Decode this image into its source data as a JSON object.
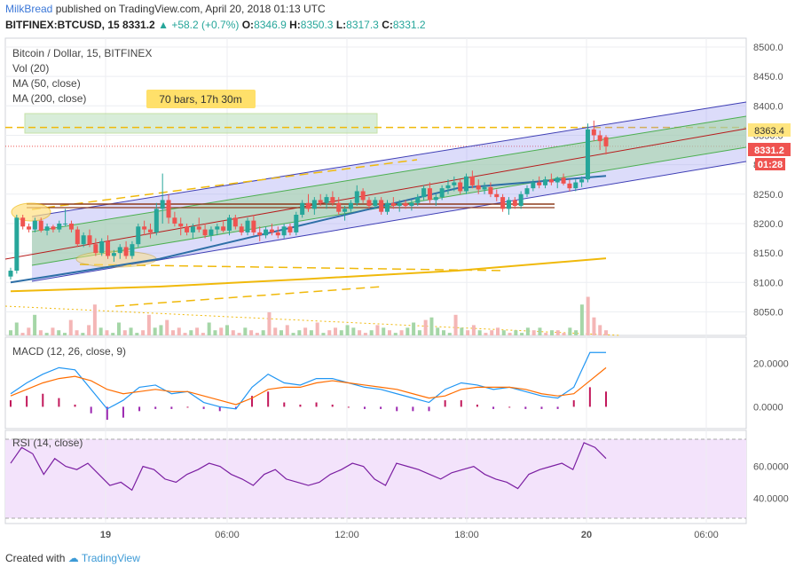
{
  "header": {
    "author": "MilkBread",
    "published": "published on TradingView.com, April 20, 2018 01:13 UTC",
    "symbol": "BITFINEX:BTCUSD, 15",
    "last": "8331.2",
    "change": "+58.2 (+0.7%)",
    "o_label": "O:",
    "o": "8346.9",
    "h_label": "H:",
    "h": "8350.3",
    "l_label": "L:",
    "l": "8317.3",
    "c_label": "C:",
    "c": "8331.2"
  },
  "legend": {
    "title": "Bitcoin / Dollar, 15, BITFINEX",
    "vol": "Vol (20)",
    "ma50": "MA (50, close)",
    "ma200": "MA (200, close)"
  },
  "annotation": {
    "bars": "70 bars, 17h 30m"
  },
  "badges": {
    "level": "8363.4",
    "last": "8331.2",
    "countdown": "01:28"
  },
  "colors": {
    "up": "#26a69a",
    "down": "#ef5350",
    "channel_blue": "#3f3fb5",
    "channel_green": "#4caf50",
    "ma50": "#2e6fa7",
    "ma200": "#f0b90b"
  },
  "chart_data": [
    {
      "type": "candlestick",
      "title": "Bitcoin / Dollar, 15, BITFINEX",
      "y_ticks": [
        "8050.0",
        "8100.0",
        "8150.0",
        "8200.0",
        "8250.0",
        "8300.0",
        "8350.0",
        "8400.0",
        "8450.0",
        "8500.0"
      ],
      "ylim": [
        8010,
        8515
      ],
      "x_ticks": [
        "19",
        "06:00",
        "12:00",
        "18:00",
        "20",
        "06:00"
      ],
      "level_8363": 8363.4,
      "candles": [
        [
          8110,
          8125,
          8105,
          8120
        ],
        [
          8120,
          8215,
          8115,
          8210
        ],
        [
          8210,
          8215,
          8190,
          8195
        ],
        [
          8195,
          8200,
          8185,
          8190
        ],
        [
          8190,
          8210,
          8185,
          8205
        ],
        [
          8205,
          8210,
          8185,
          8188
        ],
        [
          8188,
          8200,
          8180,
          8195
        ],
        [
          8195,
          8198,
          8185,
          8190
        ],
        [
          8190,
          8205,
          8185,
          8200
        ],
        [
          8200,
          8225,
          8195,
          8200
        ],
        [
          8200,
          8205,
          8185,
          8190
        ],
        [
          8190,
          8195,
          8160,
          8165
        ],
        [
          8165,
          8185,
          8160,
          8180
        ],
        [
          8180,
          8190,
          8160,
          8165
        ],
        [
          8165,
          8175,
          8145,
          8150
        ],
        [
          8150,
          8175,
          8145,
          8170
        ],
        [
          8170,
          8180,
          8140,
          8145
        ],
        [
          8145,
          8155,
          8135,
          8150
        ],
        [
          8150,
          8165,
          8140,
          8160
        ],
        [
          8160,
          8170,
          8140,
          8145
        ],
        [
          8145,
          8170,
          8140,
          8165
        ],
        [
          8165,
          8200,
          8160,
          8195
        ],
        [
          8195,
          8205,
          8180,
          8190
        ],
        [
          8190,
          8200,
          8175,
          8185
        ],
        [
          8185,
          8235,
          8180,
          8225
        ],
        [
          8225,
          8285,
          8200,
          8240
        ],
        [
          8240,
          8250,
          8200,
          8210
        ],
        [
          8210,
          8220,
          8195,
          8200
        ],
        [
          8200,
          8210,
          8180,
          8195
        ],
        [
          8195,
          8200,
          8180,
          8185
        ],
        [
          8185,
          8200,
          8175,
          8195
        ],
        [
          8195,
          8210,
          8185,
          8190
        ],
        [
          8190,
          8200,
          8175,
          8180
        ],
        [
          8180,
          8195,
          8170,
          8190
        ],
        [
          8190,
          8200,
          8180,
          8195
        ],
        [
          8195,
          8205,
          8185,
          8188
        ],
        [
          8188,
          8215,
          8180,
          8210
        ],
        [
          8210,
          8215,
          8190,
          8195
        ],
        [
          8195,
          8200,
          8180,
          8185
        ],
        [
          8185,
          8210,
          8180,
          8205
        ],
        [
          8205,
          8215,
          8180,
          8185
        ],
        [
          8185,
          8195,
          8170,
          8180
        ],
        [
          8180,
          8195,
          8175,
          8190
        ],
        [
          8190,
          8200,
          8180,
          8185
        ],
        [
          8185,
          8195,
          8175,
          8180
        ],
        [
          8180,
          8200,
          8175,
          8195
        ],
        [
          8195,
          8200,
          8180,
          8185
        ],
        [
          8185,
          8220,
          8180,
          8215
        ],
        [
          8215,
          8240,
          8210,
          8235
        ],
        [
          8235,
          8250,
          8220,
          8225
        ],
        [
          8225,
          8245,
          8215,
          8240
        ],
        [
          8240,
          8250,
          8230,
          8235
        ],
        [
          8235,
          8250,
          8225,
          8245
        ],
        [
          8245,
          8255,
          8230,
          8235
        ],
        [
          8235,
          8245,
          8215,
          8220
        ],
        [
          8220,
          8230,
          8205,
          8225
        ],
        [
          8225,
          8240,
          8220,
          8235
        ],
        [
          8235,
          8265,
          8230,
          8255
        ],
        [
          8255,
          8260,
          8235,
          8240
        ],
        [
          8240,
          8245,
          8225,
          8230
        ],
        [
          8230,
          8245,
          8225,
          8240
        ],
        [
          8240,
          8245,
          8215,
          8220
        ],
        [
          8220,
          8240,
          8215,
          8235
        ],
        [
          8235,
          8245,
          8225,
          8230
        ],
        [
          8230,
          8240,
          8220,
          8235
        ],
        [
          8235,
          8240,
          8225,
          8230
        ],
        [
          8230,
          8240,
          8222,
          8235
        ],
        [
          8235,
          8250,
          8230,
          8245
        ],
        [
          8245,
          8265,
          8240,
          8260
        ],
        [
          8260,
          8270,
          8235,
          8240
        ],
        [
          8240,
          8250,
          8230,
          8245
        ],
        [
          8245,
          8265,
          8240,
          8260
        ],
        [
          8260,
          8275,
          8250,
          8265
        ],
        [
          8265,
          8280,
          8255,
          8270
        ],
        [
          8270,
          8275,
          8250,
          8255
        ],
        [
          8255,
          8285,
          8250,
          8280
        ],
        [
          8280,
          8290,
          8260,
          8265
        ],
        [
          8265,
          8275,
          8250,
          8258
        ],
        [
          8258,
          8270,
          8250,
          8262
        ],
        [
          8262,
          8270,
          8245,
          8250
        ],
        [
          8250,
          8258,
          8238,
          8245
        ],
        [
          8245,
          8250,
          8220,
          8225
        ],
        [
          8225,
          8245,
          8215,
          8240
        ],
        [
          8240,
          8245,
          8225,
          8230
        ],
        [
          8230,
          8255,
          8225,
          8250
        ],
        [
          8250,
          8265,
          8245,
          8260
        ],
        [
          8260,
          8275,
          8255,
          8270
        ],
        [
          8270,
          8280,
          8260,
          8265
        ],
        [
          8265,
          8280,
          8260,
          8275
        ],
        [
          8275,
          8285,
          8265,
          8270
        ],
        [
          8270,
          8280,
          8260,
          8278
        ],
        [
          8278,
          8285,
          8265,
          8268
        ],
        [
          8268,
          8275,
          8255,
          8260
        ],
        [
          8260,
          8275,
          8255,
          8270
        ],
        [
          8270,
          8280,
          8262,
          8275
        ],
        [
          8275,
          8370,
          8270,
          8360
        ],
        [
          8360,
          8375,
          8340,
          8350
        ],
        [
          8350,
          8358,
          8325,
          8340
        ],
        [
          8346.9,
          8350.3,
          8317.3,
          8331.2
        ]
      ],
      "ma50": [
        8100,
        8140,
        8200,
        8260,
        8281
      ],
      "ma200": [
        8085,
        8093,
        8106,
        8120,
        8141
      ]
    },
    {
      "type": "volume",
      "title": "Vol (20)",
      "peaks": [
        2,
        5,
        1,
        3,
        8,
        2,
        1,
        3,
        2,
        1,
        6,
        2,
        1,
        4,
        12,
        3,
        2,
        1,
        5,
        2,
        3,
        1,
        2,
        8,
        3,
        4,
        6,
        2,
        3,
        1,
        2,
        3,
        1,
        5,
        2,
        3,
        4,
        2,
        1,
        3,
        2,
        1,
        2,
        9,
        3,
        2,
        4,
        1,
        2,
        3,
        2,
        5,
        1,
        2,
        3,
        2,
        4,
        3,
        2,
        1,
        2,
        4,
        3,
        2,
        1,
        2,
        3,
        5,
        2,
        6,
        7,
        3,
        2,
        1,
        8,
        3,
        2,
        4,
        2,
        1,
        2,
        3,
        2,
        1,
        2,
        1,
        3,
        2,
        3,
        1,
        2,
        2,
        1,
        3,
        2,
        12,
        15,
        7,
        4,
        2
      ]
    },
    {
      "type": "line",
      "title": "MACD (12, 26, close, 9)",
      "y_ticks": [
        "0.0000",
        "20.0000"
      ],
      "ylim": [
        -8,
        30
      ],
      "macd": [
        6,
        11,
        15,
        18,
        17,
        8,
        -1,
        3,
        9,
        10,
        6,
        7,
        2,
        0,
        -1,
        9,
        15,
        11,
        10,
        13,
        13,
        11,
        9,
        8,
        6,
        4,
        2,
        8,
        11,
        10,
        8,
        9,
        7,
        5,
        4,
        9,
        25,
        25
      ],
      "signal": [
        5,
        8,
        11,
        13,
        14,
        12,
        8,
        6,
        7,
        8,
        7,
        7,
        5,
        3,
        1,
        4,
        8,
        9,
        9,
        11,
        12,
        11,
        10,
        9,
        8,
        6,
        4,
        5,
        8,
        9,
        9,
        9,
        8,
        6,
        5,
        6,
        12,
        18
      ],
      "histogram": [
        3,
        5,
        6,
        4,
        1,
        -3,
        -6,
        -5,
        -2,
        -1,
        -1,
        0,
        -1,
        -2,
        -1,
        5,
        7,
        2,
        1,
        2,
        1,
        0,
        -1,
        -1,
        -2,
        -2,
        -2,
        3,
        3,
        1,
        -1,
        0,
        -1,
        -1,
        -1,
        3,
        9,
        7
      ]
    },
    {
      "type": "line",
      "title": "RSI (14, close)",
      "y_ticks": [
        "60.0000",
        "40.0000"
      ],
      "ylim": [
        25,
        80
      ],
      "values": [
        62,
        72,
        68,
        55,
        65,
        60,
        58,
        62,
        55,
        48,
        50,
        45,
        60,
        58,
        52,
        50,
        55,
        58,
        62,
        60,
        55,
        52,
        48,
        55,
        58,
        52,
        50,
        48,
        50,
        55,
        58,
        62,
        60,
        52,
        48,
        62,
        60,
        58,
        55,
        52,
        56,
        58,
        60,
        55,
        52,
        50,
        46,
        55,
        58,
        60,
        62,
        58,
        75,
        72,
        65
      ]
    }
  ]
}
